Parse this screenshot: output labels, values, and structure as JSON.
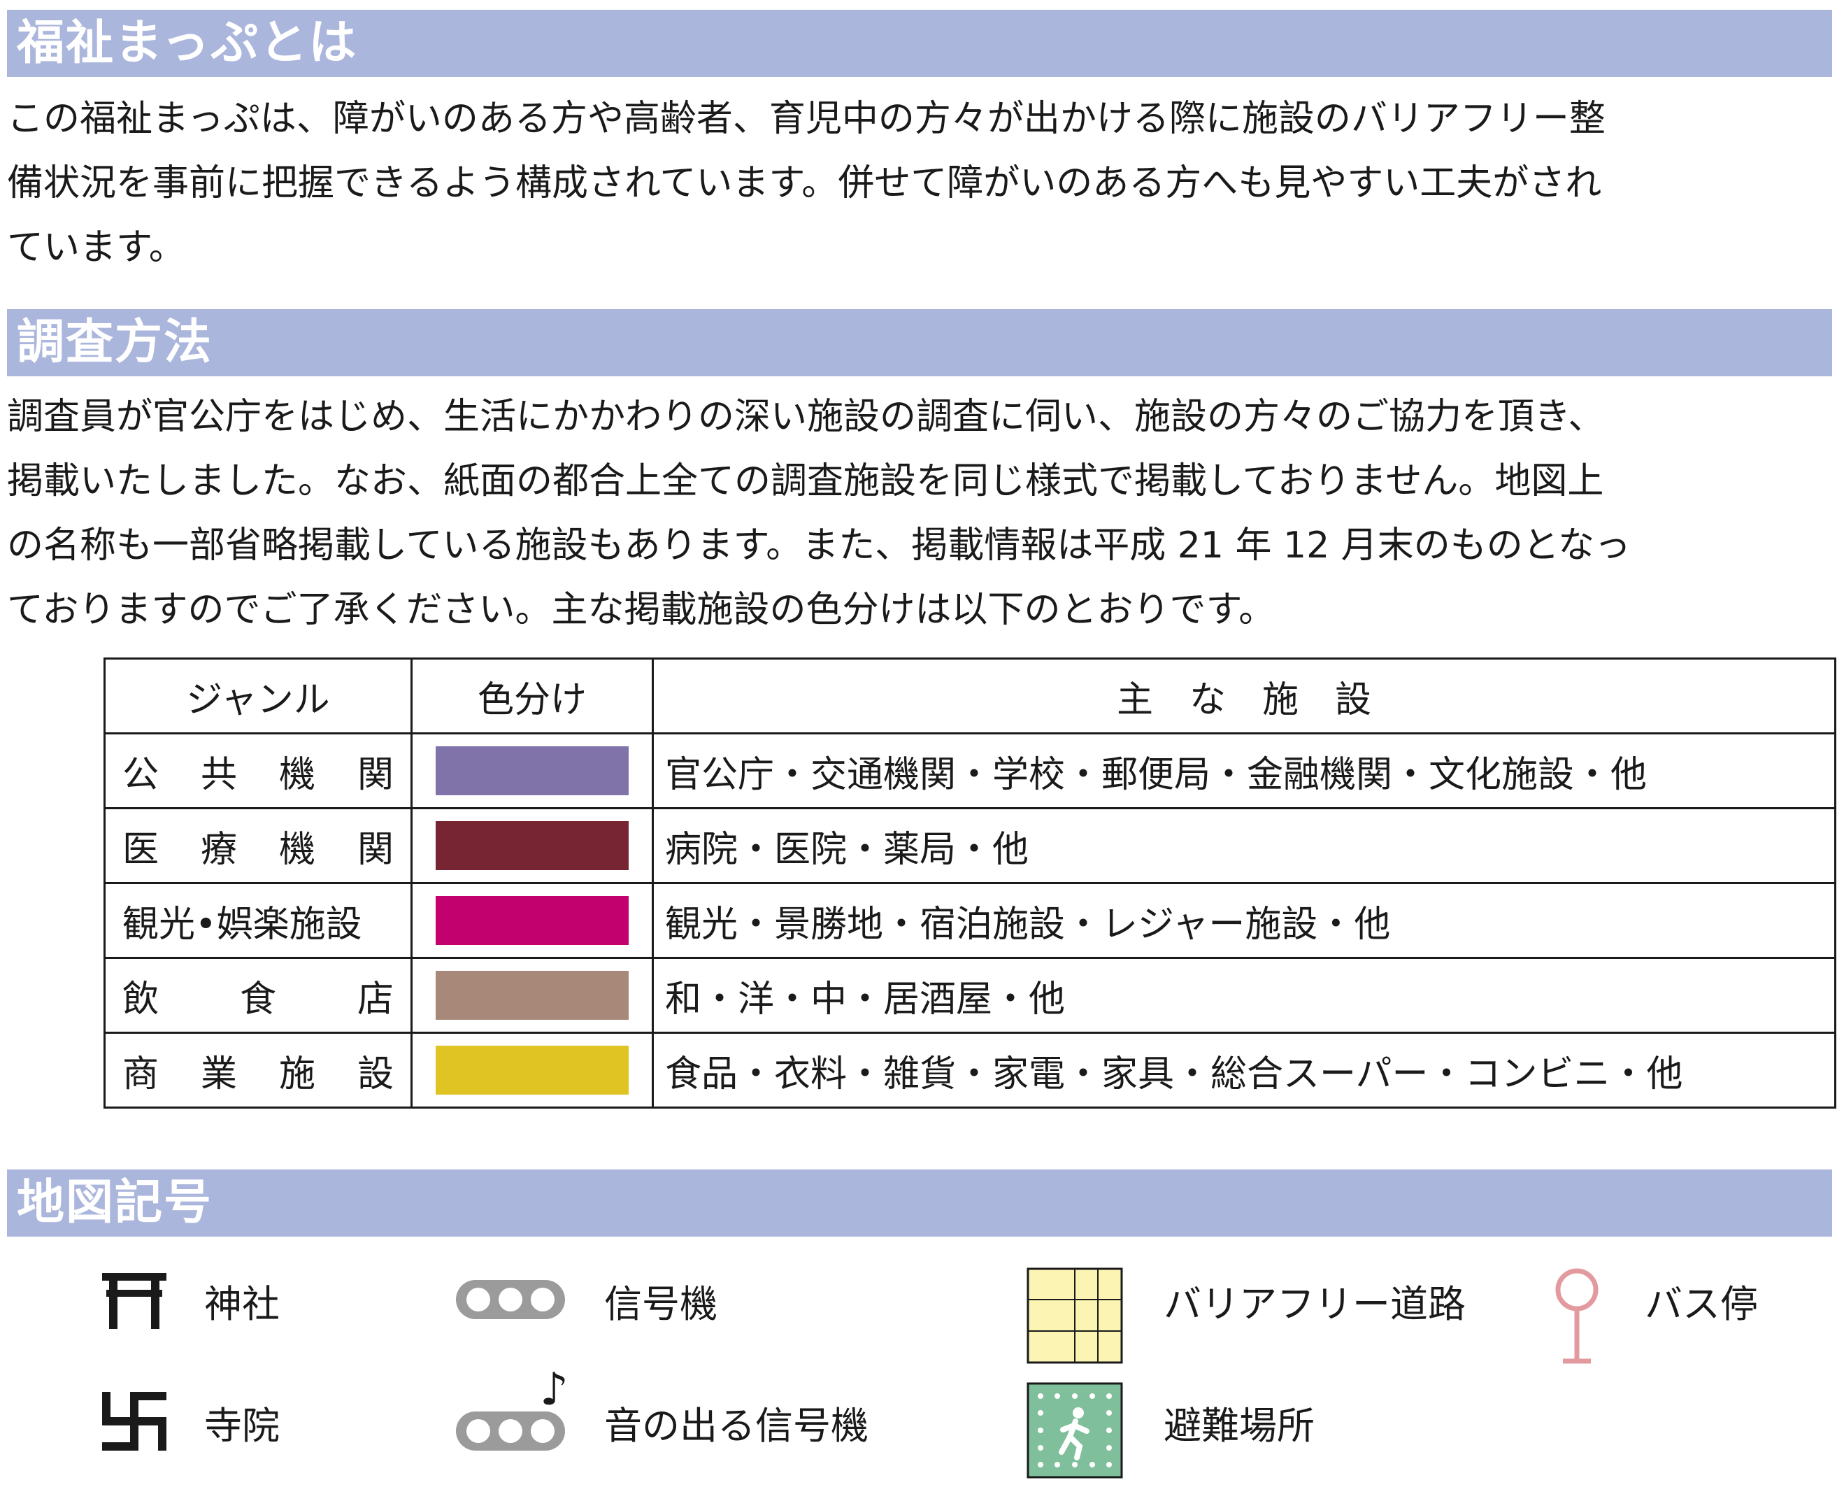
{
  "sections": {
    "about": {
      "title": "福祉まっぷとは",
      "lines": [
        "この福祉まっぷは、障がいのある方や高齢者、育児中の方々が出かける際に施設のバリアフリー整",
        "備状況を事前に把握できるよう構成されています。併せて障がいのある方へも見やすい工夫がされ",
        "ています。"
      ]
    },
    "method": {
      "title": "調査方法",
      "lines": [
        "調査員が官公庁をはじめ、生活にかかわりの深い施設の調査に伺い、施設の方々のご協力を頂き、",
        "掲載いたしました。なお、紙面の都合上全ての調査施設を同じ様式で掲載しておりません。地図上",
        "の名称も一部省略掲載している施設もあります。また、掲載情報は平成 21 年 12 月末のものとなっ",
        "ておりますのでご了承ください。主な掲載施設の色分けは以下のとおりです。"
      ]
    },
    "symbols": {
      "title": "地図記号"
    }
  },
  "genre_table": {
    "headers": [
      "ジャンル",
      "色分け",
      "主　な　施　設"
    ],
    "rows": [
      {
        "genre": [
          "公",
          "共",
          "機",
          "関"
        ],
        "color": "#7f73aa",
        "facilities": "官公庁・交通機関・学校・郵便局・金融機関・文化施設・他"
      },
      {
        "genre": [
          "医",
          "療",
          "機",
          "関"
        ],
        "color": "#772533",
        "facilities": "病院・医院・薬局・他"
      },
      {
        "genre": [
          "観光•娯楽施設"
        ],
        "color": "#c2006e",
        "facilities": "観光・景勝地・宿泊施設・レジャー施設・他"
      },
      {
        "genre": [
          "飲",
          "食",
          "店"
        ],
        "color": "#a88878",
        "facilities": "和・洋・中・居酒屋・他"
      },
      {
        "genre": [
          "商",
          "業",
          "施",
          "設"
        ],
        "color": "#e0c423",
        "facilities": "食品・衣料・雑貨・家電・家具・総合スーパー・コンビニ・他"
      }
    ]
  },
  "legend": {
    "shrine": {
      "label": "神社",
      "icon": "shrine-icon"
    },
    "temple": {
      "label": "寺院",
      "icon": "temple-icon"
    },
    "signal": {
      "label": "信号機",
      "icon": "traffic-signal-icon"
    },
    "sound_signal": {
      "label": "音の出る信号機",
      "icon": "audible-traffic-signal-icon"
    },
    "barrier_free_road": {
      "label": "バリアフリー道路",
      "icon": "barrier-free-road-icon",
      "color": "#fbf4b3"
    },
    "evacuation": {
      "label": "避難場所",
      "icon": "evacuation-site-icon",
      "color": "#7fbf9b"
    },
    "bus_stop": {
      "label": "バス停",
      "icon": "bus-stop-icon",
      "color": "#e39a9f"
    }
  }
}
